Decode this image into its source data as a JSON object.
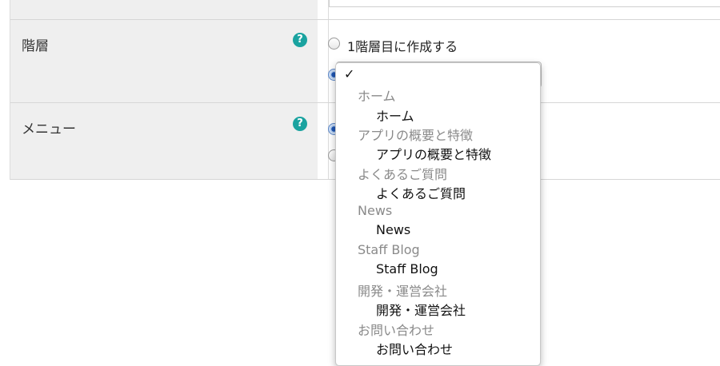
{
  "form": {
    "rows": [
      {
        "label": "階層",
        "help": "?",
        "options": [
          {
            "label": "1階層目に作成する",
            "checked": false
          },
          {
            "label": "",
            "checked": true
          }
        ]
      },
      {
        "label": "メニュー",
        "help": "?",
        "options": [
          {
            "label": "",
            "checked": true
          },
          {
            "label": "",
            "checked": false
          }
        ]
      }
    ]
  },
  "dropdown": {
    "selected_mark": "✓",
    "arrow": "▲▼",
    "groups": [
      {
        "label": "ホーム",
        "item": "ホーム"
      },
      {
        "label": "アプリの概要と特徴",
        "item": "アプリの概要と特徴"
      },
      {
        "label": "よくあるご質問",
        "item": "よくあるご質問"
      },
      {
        "label": "News",
        "item": "News"
      },
      {
        "label": "Staff Blog",
        "item": "Staff Blog"
      },
      {
        "label": "開発・運営会社",
        "item": "開発・運営会社"
      },
      {
        "label": "お問い合わせ",
        "item": "お問い合わせ"
      }
    ]
  },
  "colors": {
    "help_icon": "#1aa3a0",
    "label_background": "#efefef",
    "radio_checked": "#1e56b3"
  }
}
